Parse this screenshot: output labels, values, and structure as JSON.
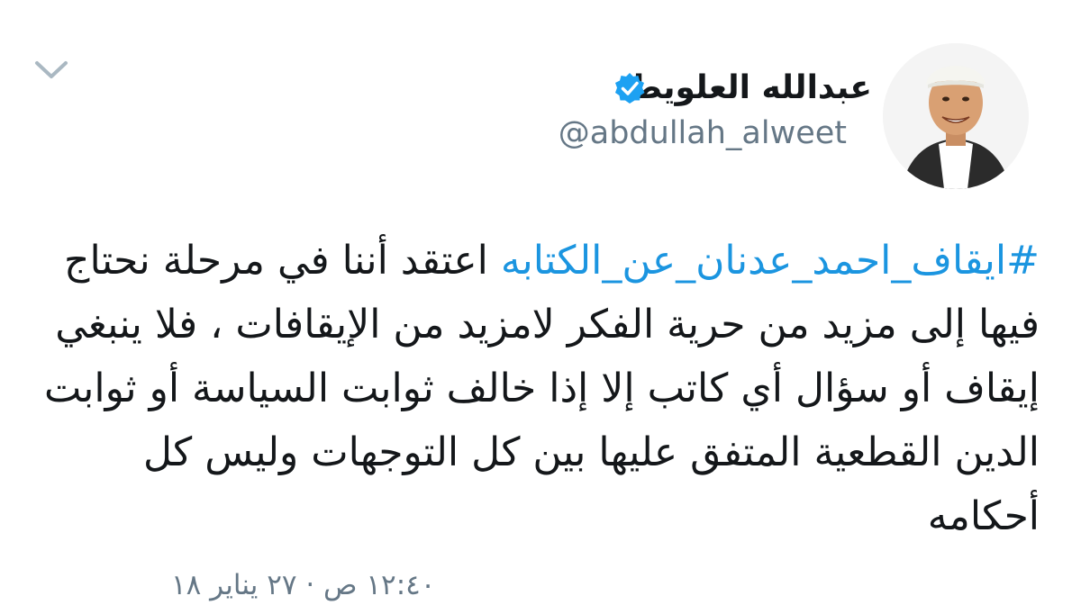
{
  "tweet": {
    "user": {
      "display_name": "عبدالله العلويط",
      "handle": "@abdullah_alweet",
      "verified": true,
      "verified_icon": "verified-badge-icon"
    },
    "menu_icon": "chevron-down-icon",
    "text": {
      "hashtag": "#ايقاف_احمد_عدنان_عن_الكتابه",
      "body": "اعتقد أننا في مرحلة نحتاج فيها إلى مزيد من حرية الفكر لامزيد من الإيقافات ، فلا ينبغي إيقاف أو سؤال أي كاتب إلا إذا خالف ثوابت السياسة أو ثوابت الدين القطعية المتفق عليها بين كل التوجهات وليس كل أحكامه"
    },
    "timestamp": "١٢:٤٠ ص · ٢٧ يناير ١٨"
  },
  "colors": {
    "text": "#14171a",
    "secondary": "#657786",
    "link": "#1b95e0",
    "verified": "#1da1f2",
    "chevron": "#aab8c2"
  }
}
